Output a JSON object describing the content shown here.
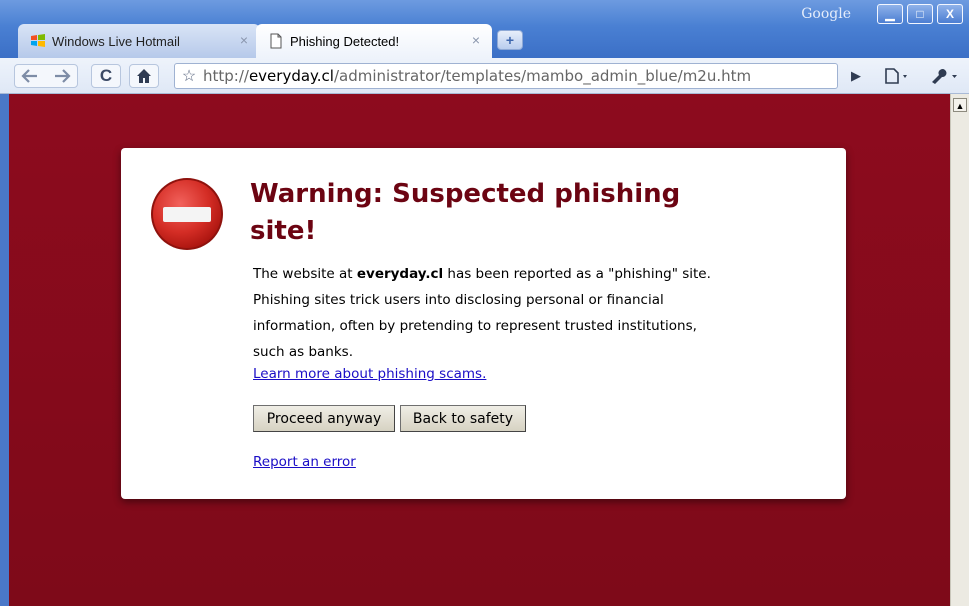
{
  "window": {
    "brand": "Google",
    "controls": {
      "minimize": "▁",
      "maximize": "□",
      "close": "X"
    }
  },
  "tabs": [
    {
      "label": "Windows Live Hotmail",
      "icon": "windows-logo-icon",
      "active": false
    },
    {
      "label": "Phishing Detected!",
      "icon": "page-icon",
      "active": true
    }
  ],
  "toolbar": {
    "url_prefix": "http://",
    "url_domain": "everyday.cl",
    "url_path": "/administrator/templates/mambo_admin_blue/m2u.htm"
  },
  "warning": {
    "title": "Warning: Suspected phishing site!",
    "desc_before": "The website at ",
    "desc_domain": "everyday.cl",
    "desc_after": " has been reported as a \"phishing\" site. Phishing sites trick users into disclosing personal or financial information, often by pretending to represent trusted institutions, such as banks.",
    "learn_more": "Learn more about phishing scams.",
    "proceed_label": "Proceed anyway",
    "back_label": "Back to safety",
    "report_label": "Report an error"
  },
  "colors": {
    "page_background": "#860b1c",
    "title_color": "#6c0412",
    "link_color": "#1a0dc6"
  }
}
